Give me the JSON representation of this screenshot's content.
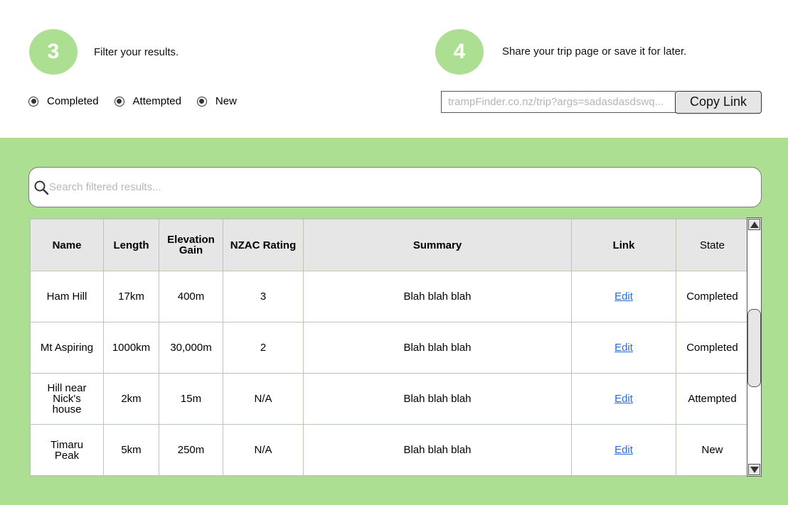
{
  "steps": [
    {
      "number": "3",
      "text": "Filter your results."
    },
    {
      "number": "4",
      "text": "Share your trip page or save it for later."
    }
  ],
  "filters": [
    "Completed",
    "Attempted",
    "New"
  ],
  "share": {
    "link_value": "trampFinder.co.nz/trip?args=sadasdasdswq...",
    "copy_label": "Copy Link"
  },
  "search": {
    "placeholder": "Search filtered results..."
  },
  "colors": {
    "accent_green": "#addf93",
    "header_gray": "#e6e6e6",
    "link_blue": "#2a6ad8"
  },
  "table": {
    "headers": {
      "name": "Name",
      "length": "Length",
      "elevation": "Elevation Gain",
      "nzac": "NZAC Rating",
      "summary": "Summary",
      "link": "Link",
      "state": "State"
    },
    "rows": [
      {
        "name": "Ham Hill",
        "length": "17km",
        "elevation": "400m",
        "nzac": "3",
        "summary": "Blah blah blah",
        "link": "Edit",
        "state": "Completed"
      },
      {
        "name": "Mt Aspiring",
        "length": "1000km",
        "elevation": "30,000m",
        "nzac": "2",
        "summary": "Blah blah blah",
        "link": "Edit",
        "state": "Completed"
      },
      {
        "name": "Hill near Nick's house",
        "length": "2km",
        "elevation": "15m",
        "nzac": "N/A",
        "summary": "Blah blah blah",
        "link": "Edit",
        "state": "Attempted"
      },
      {
        "name": "Timaru Peak",
        "length": "5km",
        "elevation": "250m",
        "nzac": "N/A",
        "summary": "Blah blah blah",
        "link": "Edit",
        "state": "New"
      }
    ]
  }
}
